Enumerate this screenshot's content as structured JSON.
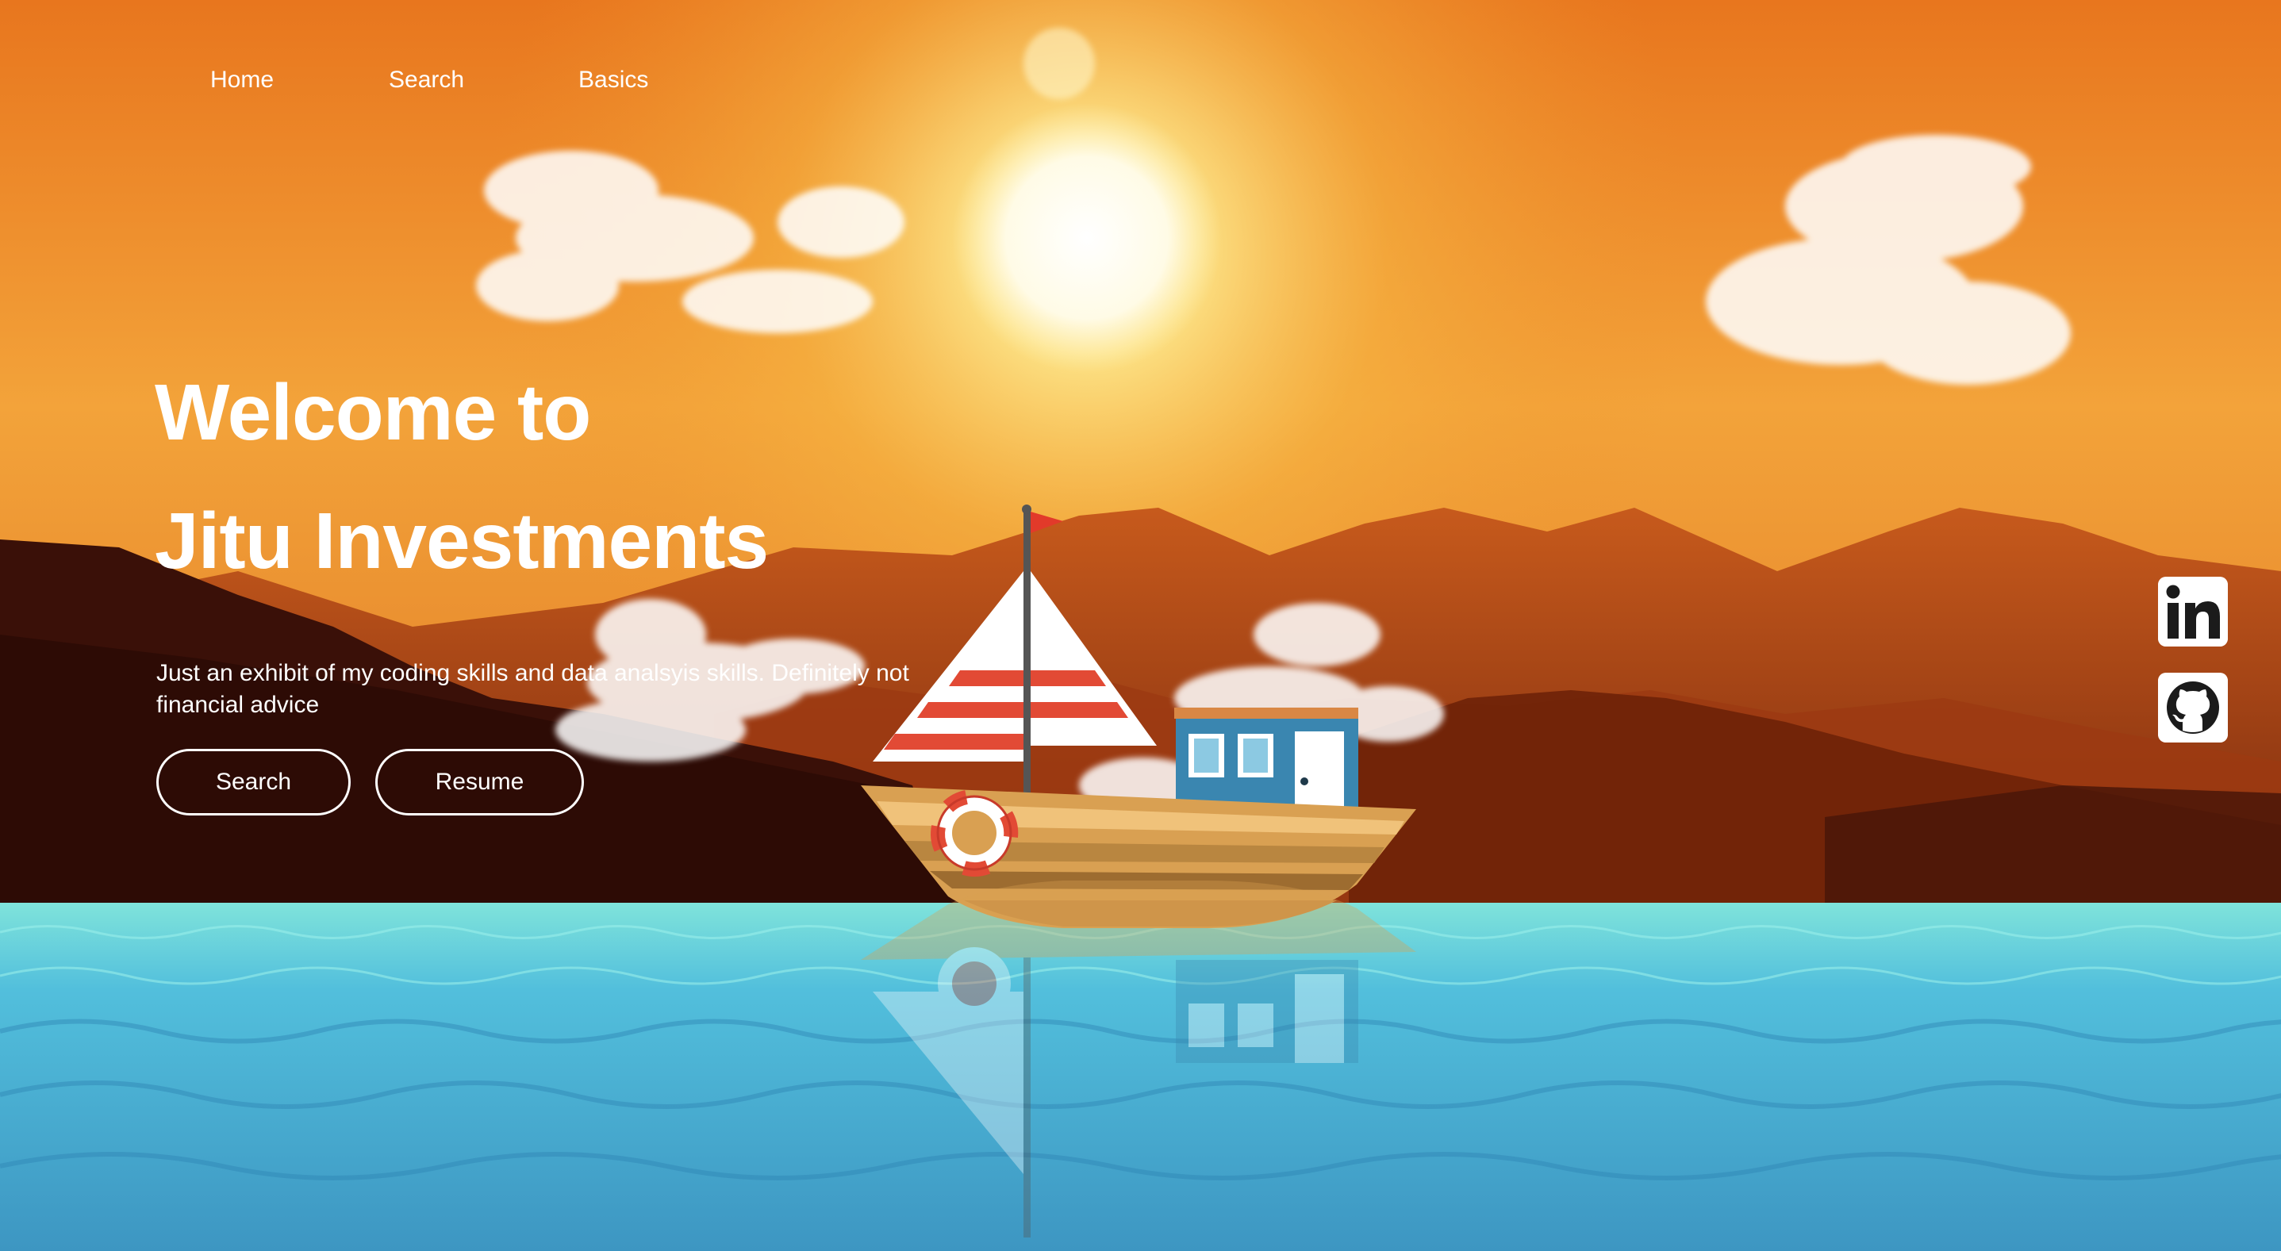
{
  "nav": {
    "home": "Home",
    "search": "Search",
    "basics": "Basics"
  },
  "hero": {
    "title_line1": "Welcome to",
    "title_line2": "Jitu Investments",
    "subtitle": "Just an exhibit of my coding skills and data analsyis skills. Definitely not financial advice",
    "search_button": "Search",
    "resume_button": "Resume"
  },
  "social": {
    "linkedin_icon": "linkedin-icon",
    "github_icon": "github-icon"
  },
  "colors": {
    "sky_top": "#f07a1c",
    "sky_glow": "#fde28a",
    "sun": "#fffdf0",
    "mountains": "#8a3410",
    "hills_dark": "#3a1008",
    "water": "#44a2c8",
    "water_light": "#7ee3de",
    "boat_hull": "#d9a052",
    "cabin": "#3a86b0",
    "sail_red": "#e24a35",
    "flag": "#e23a2a"
  }
}
